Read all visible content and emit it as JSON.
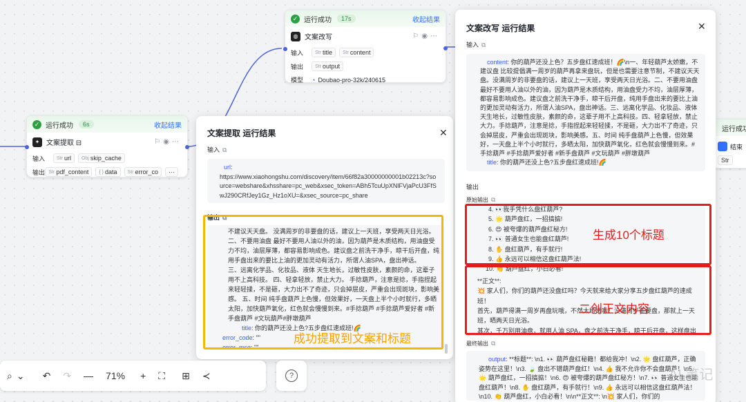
{
  "node_extract": {
    "status": "运行成功",
    "duration": "6s",
    "collapse": "收起结果",
    "title": "文案提取 ⊟",
    "input_label": "输入",
    "output_label": "输出",
    "inputs": [
      {
        "type": "Str",
        "name": "url"
      },
      {
        "type": "Obj",
        "name": "skip_cache"
      }
    ],
    "outputs": [
      {
        "type": "Str",
        "name": "pdf_content"
      },
      {
        "type": "{ }",
        "name": "data"
      },
      {
        "type": "Str",
        "name": "error_co"
      }
    ],
    "more": "···"
  },
  "node_rewrite": {
    "status": "运行成功",
    "duration": "17s",
    "collapse": "收起结果",
    "title": "文案改写",
    "input_label": "输入",
    "output_label": "输出",
    "model_label": "模型",
    "inputs": [
      {
        "type": "Str",
        "name": "title"
      },
      {
        "type": "Str",
        "name": "content"
      }
    ],
    "outputs": [
      {
        "type": "Str",
        "name": "output"
      }
    ],
    "model": "Doubao-pro-32k/240615"
  },
  "node_right": {
    "status": "运行成功",
    "title": "结束",
    "tag": "Str"
  },
  "panel_extract": {
    "title": "文案提取 运行结果",
    "close": "✕",
    "input_label": "输入",
    "input_key": "url",
    "input_url": "https://www.xiaohongshu.com/discovery/item/66f82a30000000001b02213c?source=webshare&xhsshare=pc_web&xsec_token=ABh5TcuUpXNlFVjaPcU3FfSwJ290CRfJey1Gz_Hz1oXU=&xsec_source=pc_share",
    "output_label": "输出",
    "output_lines": [
      "不建议天天盘。 没满周岁的非要盘的话，建议上一天班，享受两天日光浴。",
      "二、不要用油盘 最好不要用人油以外的油，因为葫芦是木质结构，用油盘受力不均，油层厚薄，都容易影响成色。建议盘之前洗干净手，晾干后开盘，纯用手盘出来的要比上油的更加灵动有活力，所谓人油SPA，盘出神话。",
      "三、远离化学品、化妆品、液体 天生地长，过敏性皮肤，素颜的命，这辈子用不上高科技。 四、轻拿轻放，禁止大力。 手捻葫芦，注意是捻，手指捏起来轻轻揉，不是砸，大力出不了奇迹，只会掉层皮，严重会出现斑块，影响美感。 五、时间 纯手盘葫芦上色慢，但效果好，一天盘上半个小时就行，多晒太阳，加快葫芦氧化，红色就会慢慢到来。#手捻葫芦 #手捻葫芦爱好者 #新手盘葫芦 #文玩葫芦#胖墩葫芦"
    ],
    "title_key": "title",
    "title_val": "你的葫芦还没上色?五步盘红速成班!🌈",
    "err_code_key": "error_code",
    "err_code_val": "\"\"",
    "err_msg_key": "error_msg",
    "err_msg_val": "\"\""
  },
  "panel_rewrite": {
    "title": "文案改写 运行结果",
    "close": "✕",
    "input_label": "输入",
    "content_key": "content",
    "content_val": "你的葫芦还没上色？五步盘红速成班！🌈\\n一、年轻葫芦太娇嫩，不建议盘 比较提倡满一周岁的葫芦再拿来盘玩，但是也需要注意节制，不建议天天盘。没满周岁的非要盘的话，建议上一天班，享受两天日光浴。二、不要用油盘 最好不要用人油以外的油，因为葫芦是木质结构，用油盘受力不均，油层厚薄，都容易影响成色。建议盘之前洗干净手，晾干后开盘，纯用手盘出来的要比上油的更加灵动有活力，所谓人油SPA，盘出神话。三、远离化学品、化妆品、液体 天生地长，过敏性皮肤，素颜的命，这辈子用不上高科技。四、轻拿轻放，禁止大力。手捻葫芦，注意是捻，手指捏起来轻轻揉，不是砸，大力出不了奇迹，只会掉层皮，严重会出现斑块，影响美感。五、时间 纯手盘葫芦上色慢，但效果好，一天盘上半个小时就行，多晒太阳，加快葫芦氧化，红色就会慢慢到来。#手捻葫芦 #手捻葫芦爱好者 #新手盘葫芦 #文玩葫芦 #胖墩葫芦",
    "title_key": "title",
    "title_val": "你的葫芦还没上色?五步盘红速成班!🌈",
    "output_label": "输出",
    "raw_label": "原始输出",
    "raw_lines": [
      "4. 👀我手凭什么盘红葫芦?",
      "5. 🌟 葫芦盘红，一招搞掂!",
      "6. 😍 被夸爆的葫芦盘红秘方!",
      "7. 👀 普通女生也能盘红葫芦!",
      "8. ✋ 盘红葫芦，有手就行!",
      "9. 👍 永远可以相信这盘红葫芦法!",
      "10. 👏 葫芦盘红，小白必看!",
      "**正文**:",
      "💥 家人们，你们的葫芦还没盘红吗？今天就来给大家分享五步盘红葫芦的速成班！",
      "首先，葫芦得满一周岁再盘玩哦，不然太娇嫩啦！没满周岁非要盘，那就上一天班，晒两天日光浴。",
      "其次，千万别用油盘，就用人油 SPA，盘之前洗干净手，晾干后开盘，这样盘出来的葫芦灵动又有活力！"
    ],
    "final_label": "最终输出",
    "final_key": "output",
    "final_val": "**标题**: \\n1. 👀 葫芦盘红秘籍！都给我冲！\\n2. 🌟 盘红葫芦，正确姿势在这里！\\n3. 🍃 盘出不错葫芦盘红！\\n4. 👍 我不允许你不会盘葫芦！\\n5. 🌟 葫芦盘红，一招搞掂！\\n6. 😍 被夸爆的葫芦盘红秘方！\\n7. 👀 普通女生也能盘红葫芦！\\n8. ✋ 盘红葫芦，有手就行！\\n9. 👍 永远可以相信这盘红葫芦法！\\n10. 👏 葫芦盘红，小白必看！\\n\\n**正文**: \\n💥 家人们，你们的"
  },
  "annotations": {
    "yellow": "成功提取到文案和标题",
    "red_1": "生成10个标题",
    "red_2": "二创正文内容",
    "watermark": "AI 笔记"
  },
  "toolbar": {
    "pointer": "⌕",
    "chev": "⌄",
    "undo": "↶",
    "redo": "↷",
    "minus": "—",
    "zoom": "71%",
    "plus": "+",
    "fit": "⛶",
    "layout": "⊞",
    "branch": "≺",
    "help": "?"
  },
  "colors": {
    "accent": "#3370ff",
    "success": "#2ea043",
    "yellow_box": "#f5b800",
    "red_box": "#e41c1c",
    "anno_yellow": "#f5a300",
    "anno_red": "#e41c1c"
  }
}
